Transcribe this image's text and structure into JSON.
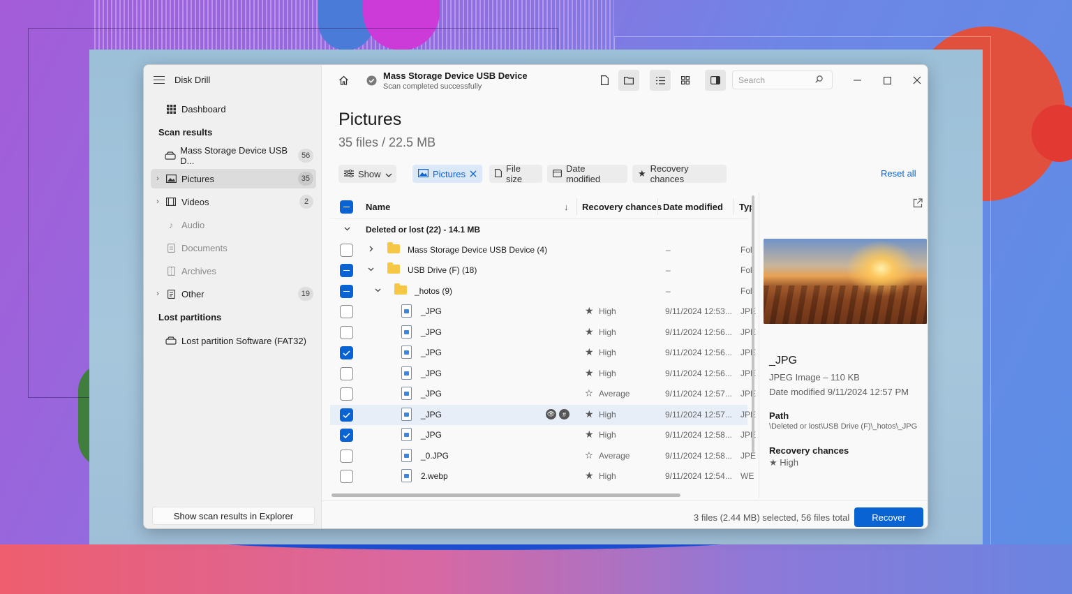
{
  "app": {
    "title": "Disk Drill"
  },
  "sidebar": {
    "dashboard": "Dashboard",
    "scan_results_title": "Scan results",
    "device_item": {
      "label": "Mass Storage Device USB D...",
      "count": "56"
    },
    "categories": [
      {
        "label": "Pictures",
        "count": "35",
        "icon": "image-icon"
      },
      {
        "label": "Videos",
        "count": "2",
        "icon": "film-icon"
      },
      {
        "label": "Audio",
        "count": "",
        "icon": "music-note-icon"
      },
      {
        "label": "Documents",
        "count": "",
        "icon": "document-icon"
      },
      {
        "label": "Archives",
        "count": "",
        "icon": "archive-icon"
      },
      {
        "label": "Other",
        "count": "19",
        "icon": "file-icon"
      }
    ],
    "lost_partitions_title": "Lost partitions",
    "lost_partition_item": "Lost partition Software (FAT32)",
    "explorer_button": "Show scan results in Explorer"
  },
  "topbar": {
    "device_name": "Mass Storage Device USB Device",
    "device_status": "Scan completed successfully",
    "search_placeholder": "Search"
  },
  "page": {
    "title": "Pictures",
    "subtitle": "35 files / 22.5 MB"
  },
  "filters": {
    "show": "Show",
    "pictures": "Pictures",
    "file_size": "File size",
    "date_modified": "Date modified",
    "recovery_chances": "Recovery chances",
    "reset_all": "Reset all"
  },
  "table": {
    "headers": {
      "name": "Name",
      "recovery": "Recovery chances",
      "date": "Date modified",
      "type": "Typ"
    },
    "group": "Deleted or lost (22) - 14.1 MB",
    "folders": [
      {
        "name": "Mass Storage Device USB Device (4)",
        "date": "–",
        "type": "Fol"
      },
      {
        "name": "USB Drive (F) (18)",
        "date": "–",
        "type": "Fol"
      },
      {
        "name": "_hotos (9)",
        "date": "–",
        "type": "Fol"
      }
    ],
    "files": [
      {
        "name": "_JPG",
        "recovery": "High",
        "date": "9/11/2024 12:53...",
        "type": "JPE"
      },
      {
        "name": "_JPG",
        "recovery": "High",
        "date": "9/11/2024 12:56...",
        "type": "JPE"
      },
      {
        "name": "_JPG",
        "recovery": "High",
        "date": "9/11/2024 12:56...",
        "type": "JPE"
      },
      {
        "name": "_JPG",
        "recovery": "High",
        "date": "9/11/2024 12:56...",
        "type": "JPE"
      },
      {
        "name": "_JPG",
        "recovery": "Average",
        "date": "9/11/2024 12:57...",
        "type": "JPE"
      },
      {
        "name": "_JPG",
        "recovery": "High",
        "date": "9/11/2024 12:57...",
        "type": "JPE"
      },
      {
        "name": "_JPG",
        "recovery": "High",
        "date": "9/11/2024 12:58...",
        "type": "JPE"
      },
      {
        "name": "_0.JPG",
        "recovery": "Average",
        "date": "9/11/2024 12:58...",
        "type": "JPE"
      },
      {
        "name": "2.webp",
        "recovery": "High",
        "date": "9/11/2024 12:54...",
        "type": "WE"
      }
    ]
  },
  "preview": {
    "name": "_JPG",
    "type": "JPEG Image – 110 KB",
    "date": "Date modified 9/11/2024 12:57 PM",
    "path_label": "Path",
    "path": "\\Deleted or lost\\USB Drive (F)\\_hotos\\_JPG",
    "recovery_label": "Recovery chances",
    "recovery": "High"
  },
  "footer": {
    "selection": "3 files (2.44 MB) selected, 56 files total",
    "recover": "Recover"
  },
  "colors": {
    "accent": "#0a63d2",
    "folder": "#f6c744"
  }
}
